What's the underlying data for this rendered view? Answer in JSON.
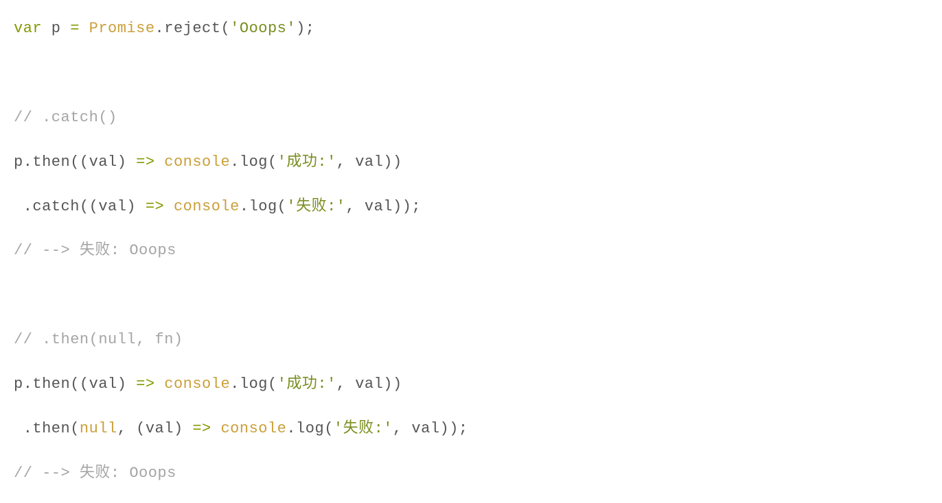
{
  "code": {
    "line1": {
      "t1": "var",
      "t2": " p ",
      "t3": "=",
      "t4": " ",
      "t5": "Promise",
      "t6": ".reject(",
      "t7": "'Ooops'",
      "t8": ");"
    },
    "line3": "// .catch()",
    "line4": {
      "t1": "p.then((val) ",
      "t2": "=>",
      "t3": " ",
      "t4": "console",
      "t5": ".log(",
      "t6": "'成功:'",
      "t7": ", val))"
    },
    "line5": {
      "t1": " .catch((val) ",
      "t2": "=>",
      "t3": " ",
      "t4": "console",
      "t5": ".log(",
      "t6": "'失败:'",
      "t7": ", val));"
    },
    "line6": "// --> 失败: Ooops",
    "line8": "// .then(null, fn)",
    "line9": {
      "t1": "p.then((val) ",
      "t2": "=>",
      "t3": " ",
      "t4": "console",
      "t5": ".log(",
      "t6": "'成功:'",
      "t7": ", val))"
    },
    "line10": {
      "t1": " .then(",
      "t2": "null",
      "t3": ", (val) ",
      "t4": "=>",
      "t5": " ",
      "t6": "console",
      "t7": ".log(",
      "t8": "'失败:'",
      "t9": ", val));"
    },
    "line11": "// --> 失败: Ooops"
  }
}
